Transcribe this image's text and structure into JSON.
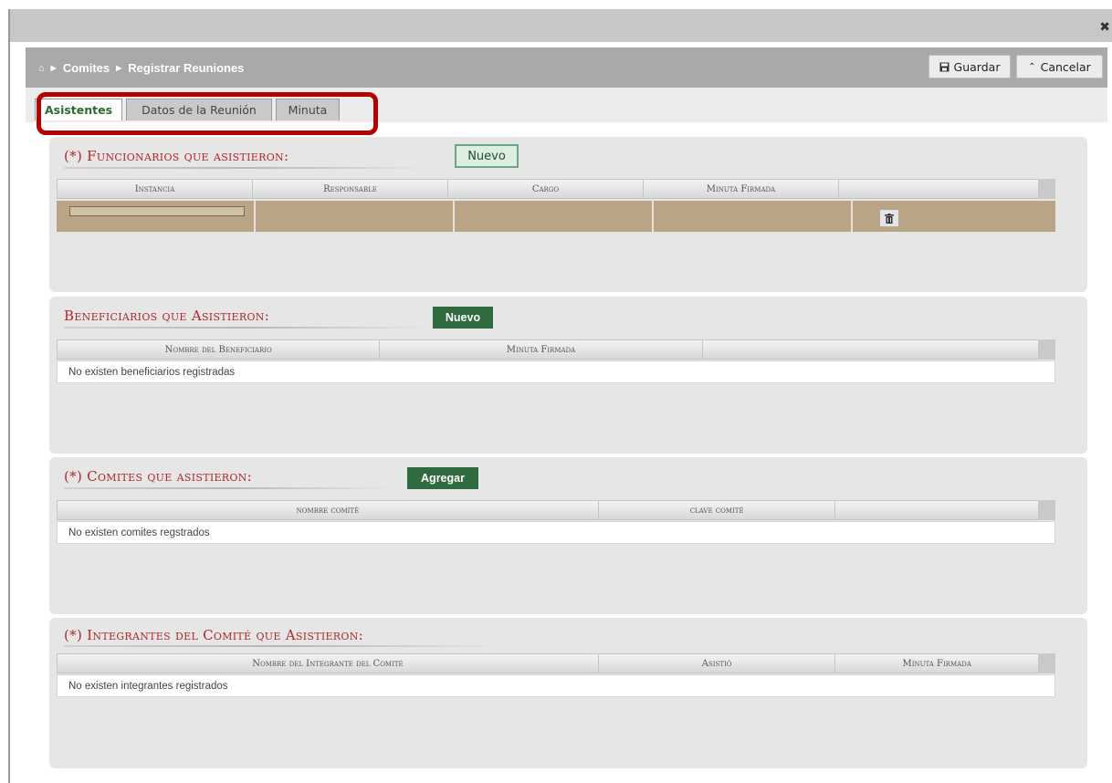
{
  "window": {
    "close_glyph": "✖"
  },
  "breadcrumb": {
    "items": [
      "Comites",
      "Registrar Reuniones"
    ]
  },
  "toolbar": {
    "save_label": "Guardar",
    "cancel_label": "Cancelar"
  },
  "tabs": [
    {
      "label": "Asistentes",
      "active": true
    },
    {
      "label": "Datos de la Reunión",
      "active": false
    },
    {
      "label": "Minuta",
      "active": false
    }
  ],
  "sections": {
    "funcionarios": {
      "title": "(*) Funcionarios que asistieron:",
      "button": "Nuevo",
      "columns": [
        "Instancia",
        "Responsable",
        "Cargo",
        "Minuta Firmada",
        ""
      ],
      "row": {
        "instancia": "",
        "responsable": "",
        "cargo": "",
        "minuta_firmada": ""
      }
    },
    "beneficiarios": {
      "title": "Beneficiarios que Asistieron:",
      "button": "Nuevo",
      "columns": [
        "Nombre del Beneficiario",
        "Minuta Firmada",
        ""
      ],
      "empty": "No existen beneficiarios registradas"
    },
    "comites": {
      "title": "(*) Comites que asistieron:",
      "button": "Agregar",
      "columns": [
        "nombre comité",
        "clave comité",
        ""
      ],
      "empty": "No existen comites regstrados"
    },
    "integrantes": {
      "title": "(*) Integrantes del Comité que Asistieron:",
      "columns": [
        "Nombre del Integrante del Comité",
        "Asistió",
        "Minuta Firmada"
      ],
      "empty": "No existen integrantes registrados"
    }
  },
  "colors": {
    "accent_red": "#b0262a",
    "button_green": "#2f6b3f",
    "highlight_red": "#b40000",
    "row_selected": "#b9a486"
  },
  "icons": [
    "home-icon",
    "chevron-right-icon",
    "save-icon",
    "chevron-up-icon",
    "trash-icon",
    "close-icon"
  ]
}
